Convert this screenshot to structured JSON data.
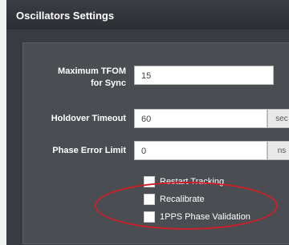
{
  "panel": {
    "title": "Oscillators Settings"
  },
  "form": {
    "max_tfom": {
      "label_line1": "Maximum TFOM",
      "label_line2": "for Sync",
      "value": "15"
    },
    "holdover_timeout": {
      "label": "Holdover Timeout",
      "value": "60",
      "unit": "sec"
    },
    "phase_error_limit": {
      "label": "Phase Error Limit",
      "value": "0",
      "unit": "ns"
    },
    "checkboxes": [
      {
        "label": "Restart Tracking",
        "checked": false
      },
      {
        "label": "Recalibrate",
        "checked": false
      },
      {
        "label": "1PPS Phase Validation",
        "checked": false
      }
    ]
  },
  "annotation": {
    "highlight_color": "#cc1f28"
  }
}
